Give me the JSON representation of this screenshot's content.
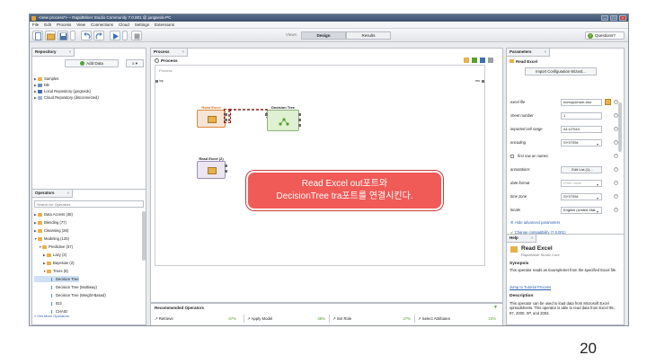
{
  "window": {
    "title": "<new process*> – RapidMiner Studio Community 7.0.001 @ jungseok-PC"
  },
  "menu": [
    "File",
    "Edit",
    "Process",
    "View",
    "Connections",
    "Cloud",
    "Settings",
    "Extensions"
  ],
  "toolbar": {
    "views_label": "Views:",
    "tabs": [
      "Design",
      "Results"
    ],
    "active_tab": "Design",
    "questions_label": "Questions?"
  },
  "repository": {
    "tab": "Repository",
    "add_data_label": "Add Data",
    "items": [
      "Samples",
      "DB",
      "Local Repository (jungseok)",
      "Cloud Repository (disconnected)"
    ]
  },
  "operators": {
    "tab": "Operators",
    "search_placeholder": "Search for Operators",
    "items": [
      {
        "label": "Data Access (46)",
        "level": 0,
        "type": "folder",
        "open": false
      },
      {
        "label": "Blending (77)",
        "level": 0,
        "type": "folder",
        "open": false
      },
      {
        "label": "Cleansing (26)",
        "level": 0,
        "type": "folder",
        "open": false
      },
      {
        "label": "Modeling (125)",
        "level": 0,
        "type": "folder",
        "open": true
      },
      {
        "label": "Predictive (57)",
        "level": 1,
        "type": "folder",
        "open": true
      },
      {
        "label": "Lazy (2)",
        "level": 2,
        "type": "folder",
        "open": false
      },
      {
        "label": "Bayesian (2)",
        "level": 2,
        "type": "folder",
        "open": false
      },
      {
        "label": "Trees (8)",
        "level": 2,
        "type": "folder",
        "open": true
      },
      {
        "label": "Decision Tree",
        "level": 3,
        "type": "leaf",
        "selected": true
      },
      {
        "label": "Decision Tree (Multiway)",
        "level": 3,
        "type": "leaf"
      },
      {
        "label": "Decision Tree (Weight-Based)",
        "level": 3,
        "type": "leaf"
      },
      {
        "label": "ID3",
        "level": 3,
        "type": "leaf"
      },
      {
        "label": "CHAID",
        "level": 3,
        "type": "leaf"
      }
    ],
    "more_link": "» Get More Operators"
  },
  "process": {
    "tab": "Process",
    "header": "Process",
    "breadcrumb": "Process",
    "inp_label": "inp",
    "res_label": "res",
    "operators": {
      "read_excel": "Read Excel",
      "decision_tree": "Decision Tree",
      "read_excel_2": "Read Excel (2)"
    }
  },
  "callout": {
    "line1": "Read Excel out포트와",
    "line2": "DecisionTree tra포트를 연결시킨다."
  },
  "recommended": {
    "title": "Recommended Operators",
    "items": [
      {
        "label": "Retrieve",
        "pct": "67%"
      },
      {
        "label": "Apply Model",
        "pct": "38%"
      },
      {
        "label": "Set Role",
        "pct": "27%"
      },
      {
        "label": "Select Attributes",
        "pct": "23%"
      }
    ]
  },
  "parameters": {
    "tab": "Parameters",
    "operator_name": "Read Excel",
    "import_btn": "Import Configuration Wizard...",
    "rows": [
      {
        "label": "excel file",
        "value": "ecrtop(tchum.xlsx",
        "kind": "file"
      },
      {
        "label": "sheet number",
        "value": "1",
        "kind": "text"
      },
      {
        "label": "imported cell range",
        "value": "A1:U7044",
        "kind": "text"
      },
      {
        "label": "encoding",
        "value": "SYSTEM",
        "kind": "select"
      },
      {
        "label": "first row as names",
        "value": "",
        "kind": "check"
      },
      {
        "label": "annotations",
        "value": "Edit List (1)...",
        "kind": "button"
      },
      {
        "label": "date format",
        "value": "Enter value",
        "kind": "select"
      },
      {
        "label": "time zone",
        "value": "SYSTEM",
        "kind": "select"
      },
      {
        "label": "locale",
        "value": "English (United Stat...",
        "kind": "select"
      }
    ],
    "hide_advanced": "Hide advanced parameters",
    "change_compat": "Change compatibility (7.0.001)"
  },
  "help": {
    "tab": "Help",
    "title": "Read Excel",
    "subtitle": "RapidMiner Studio Core",
    "synopsis_h": "Synopsis",
    "synopsis": "This operator reads an ExampleSet from the specified Excel file.",
    "tutorial_link": "Jump to Tutorial Process",
    "description_h": "Description",
    "description": "This operator can be used to load data from Microsoft Excel spreadsheets. This operator is able to read data from Excel 95, 97, 2000, XP, and 2003."
  },
  "page_number": "20",
  "colors": {
    "callout": "#f05a57",
    "connector": "#8b1b1b",
    "accent": "#3a6fb0"
  }
}
